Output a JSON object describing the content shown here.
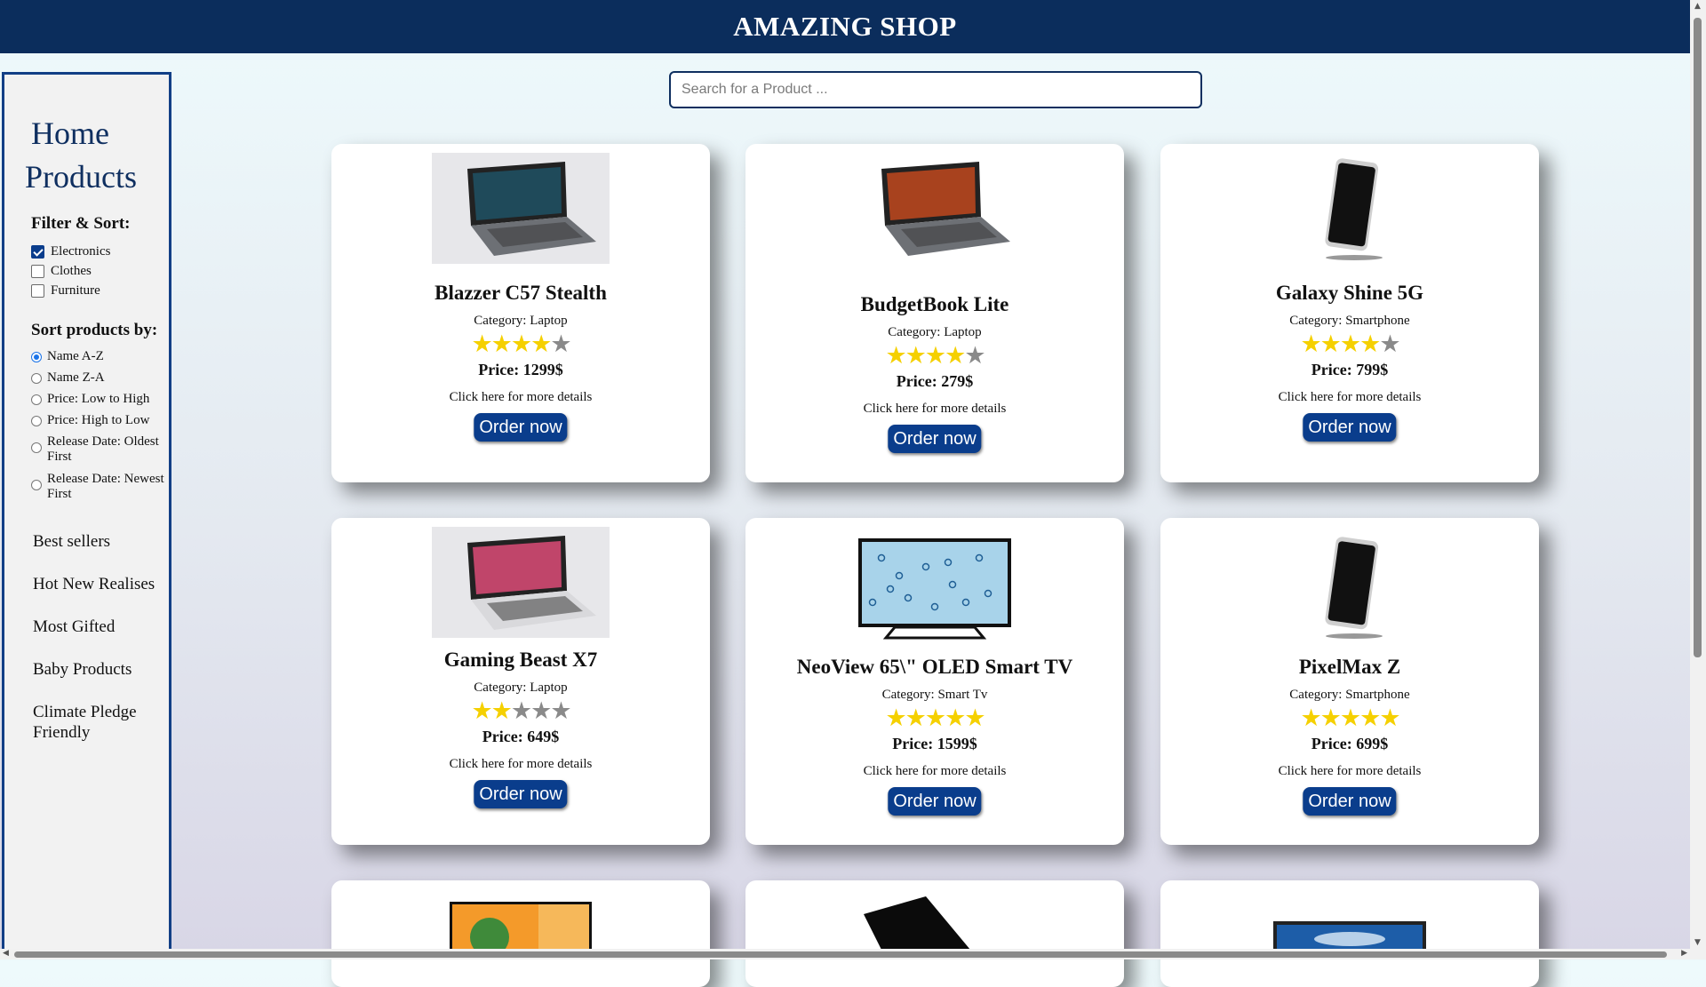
{
  "header": {
    "title": "AMAZING SHOP"
  },
  "search": {
    "placeholder": "Search for a Product ..."
  },
  "sidebar": {
    "nav": [
      "Home",
      "Products"
    ],
    "filter_title": "Filter & Sort:",
    "filters": [
      {
        "label": "Electronics",
        "checked": true
      },
      {
        "label": "Clothes",
        "checked": false
      },
      {
        "label": "Furniture",
        "checked": false
      }
    ],
    "sort_title": "Sort products by:",
    "sort_options": [
      {
        "label": "Name A-Z",
        "selected": true
      },
      {
        "label": "Name Z-A",
        "selected": false
      },
      {
        "label": "Price: Low to High",
        "selected": false
      },
      {
        "label": "Price: High to Low",
        "selected": false
      },
      {
        "label": "Release Date: Oldest First",
        "selected": false
      },
      {
        "label": "Release Date: Newest First",
        "selected": false
      }
    ],
    "links": [
      "Best sellers",
      "Hot New Realises",
      "Most Gifted",
      "Baby Products",
      "Climate Pledge Friendly"
    ]
  },
  "products": [
    {
      "name": "Blazzer C57 Stealth",
      "category": "Category: Laptop",
      "rating": 4,
      "price": "Price: 1299$",
      "details": "Click here for more details",
      "order_label": "Order now",
      "image": "laptop-photo"
    },
    {
      "name": "BudgetBook Lite",
      "category": "Category: Laptop",
      "rating": 4,
      "price": "Price: 279$",
      "details": "Click here for more details",
      "order_label": "Order now",
      "image": "laptop-photo"
    },
    {
      "name": "Galaxy Shine 5G",
      "category": "Category: Smartphone",
      "rating": 4,
      "price": "Price: 799$",
      "details": "Click here for more details",
      "order_label": "Order now",
      "image": "smartphone-photo"
    },
    {
      "name": "Gaming Beast X7",
      "category": "Category: Laptop",
      "rating": 2,
      "price": "Price: 649$",
      "details": "Click here for more details",
      "order_label": "Order now",
      "image": "laptop-photo"
    },
    {
      "name": "NeoView 65\\\" OLED Smart TV",
      "category": "Category: Smart Tv",
      "rating": 5,
      "price": "Price: 1599$",
      "details": "Click here for more details",
      "order_label": "Order now",
      "image": "tv-photo"
    },
    {
      "name": "PixelMax Z",
      "category": "Category: Smartphone",
      "rating": 5,
      "price": "Price: 699$",
      "details": "Click here for more details",
      "order_label": "Order now",
      "image": "smartphone-photo"
    }
  ],
  "partial_products": [
    {
      "image": "tv-photo"
    },
    {
      "image": "tablet-photo"
    },
    {
      "image": "tv-photo"
    }
  ],
  "colors": {
    "header": "#0b2d5c",
    "accent": "#0a3d8c",
    "star_on": "#f5d000",
    "star_off": "#8a8a8a"
  }
}
